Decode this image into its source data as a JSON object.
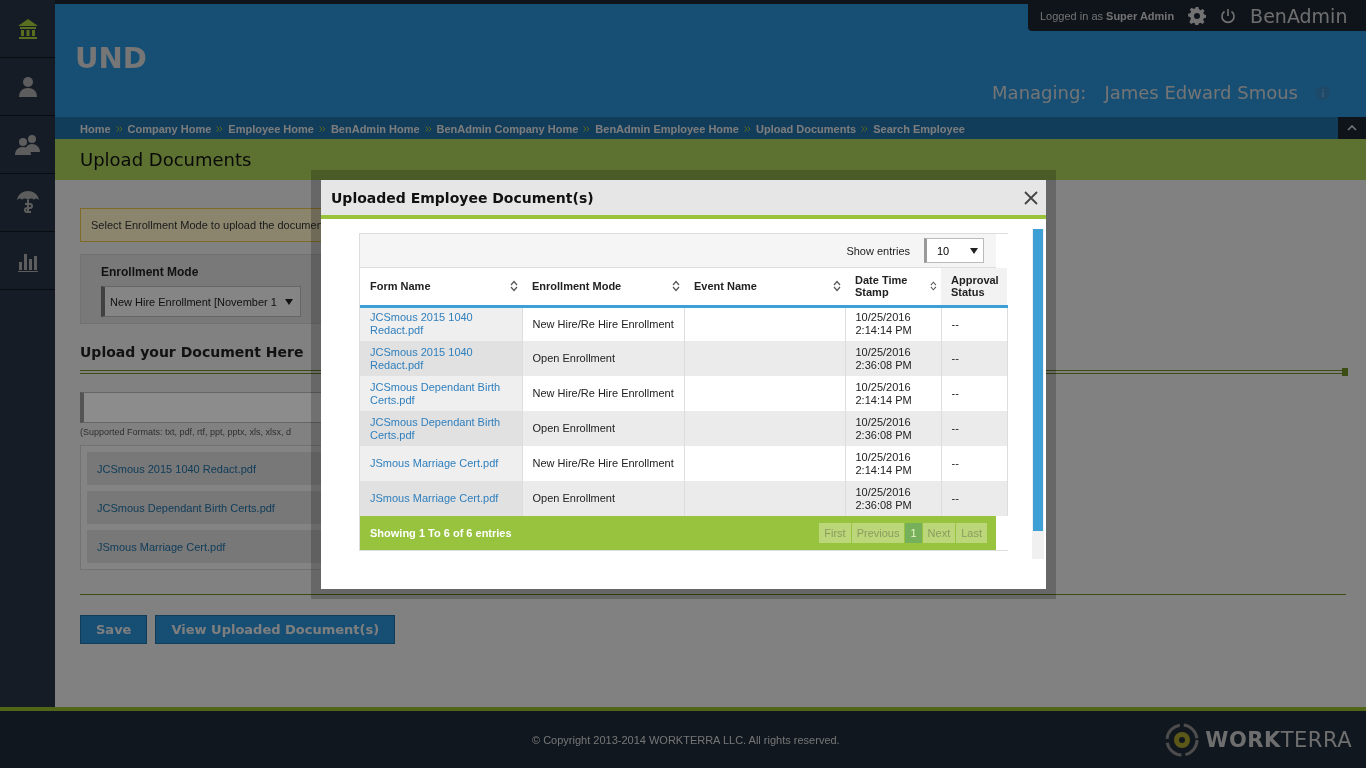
{
  "sidebar": {
    "items": [
      {
        "selected": true
      },
      {
        "selected": false
      },
      {
        "selected": false
      },
      {
        "selected": false
      },
      {
        "selected": false
      }
    ]
  },
  "header": {
    "title": "UND",
    "login_prefix": "Logged in as",
    "login_user": "Super Admin",
    "app_name": "BenAdmin",
    "managing_label": "Managing:",
    "managing_name": "James Edward Smous"
  },
  "breadcrumbs": [
    "Home",
    "Company Home",
    "Employee Home",
    "BenAdmin Home",
    "BenAdmin Company Home",
    "BenAdmin Employee Home",
    "Upload Documents",
    "Search Employee"
  ],
  "page_title": "Upload Documents",
  "notice": "Select Enrollment Mode to upload the documen",
  "enrollment": {
    "label": "Enrollment Mode",
    "value": "New Hire Enrollment [November 1"
  },
  "upload": {
    "heading": "Upload your Document Here",
    "formats": "(Supported Formats: txt, pdf, rtf, ppt, pptx, xls, xlsx, d",
    "files": [
      "JCSmous 2015 1040 Redact.pdf",
      "JCSmous Dependant Birth Certs.pdf",
      "JSmous Marriage Cert.pdf"
    ]
  },
  "buttons": [
    "Save",
    "View Uploaded Document(s)"
  ],
  "footer": {
    "copyright": "© Copyright 2013-2014 WORKTERRA LLC. All rights reserved.",
    "logo": "**WORK**TERRA"
  },
  "modal": {
    "title": "Uploaded Employee Document(s)",
    "show_entries_label": "Show entries",
    "show_entries_value": "10",
    "columns": [
      {
        "label": "Form Name",
        "sortable": true
      },
      {
        "label": "Enrollment Mode",
        "sortable": true
      },
      {
        "label": "Event Name",
        "sortable": true
      },
      {
        "label": "Date Time Stamp",
        "sortable": true
      },
      {
        "label": "Approval Status",
        "sortable": false
      }
    ],
    "rows": [
      {
        "form": "JCSmous 2015 1040 Redact.pdf",
        "mode": "New Hire/Re Hire Enrollment",
        "event": "",
        "date": "10/25/2016",
        "time": "2:14:14 PM",
        "status": "--"
      },
      {
        "form": "JCSmous 2015 1040 Redact.pdf",
        "mode": "Open Enrollment",
        "event": "",
        "date": "10/25/2016",
        "time": "2:36:08 PM",
        "status": "--"
      },
      {
        "form": "JCSmous Dependant Birth Certs.pdf",
        "mode": "New Hire/Re Hire Enrollment",
        "event": "",
        "date": "10/25/2016",
        "time": "2:14:14 PM",
        "status": "--"
      },
      {
        "form": "JCSmous Dependant Birth Certs.pdf",
        "mode": "Open Enrollment",
        "event": "",
        "date": "10/25/2016",
        "time": "2:36:08 PM",
        "status": "--"
      },
      {
        "form": "JSmous Marriage Cert.pdf",
        "mode": "New Hire/Re Hire Enrollment",
        "event": "",
        "date": "10/25/2016",
        "time": "2:14:14 PM",
        "status": "--"
      },
      {
        "form": "JSmous Marriage Cert.pdf",
        "mode": "Open Enrollment",
        "event": "",
        "date": "10/25/2016",
        "time": "2:36:08 PM",
        "status": "--"
      }
    ],
    "info": "Showing 1 To 6 of 6 entries",
    "pagination": [
      {
        "label": "First",
        "selected": false,
        "disabled": true
      },
      {
        "label": "Previous",
        "selected": false,
        "disabled": true
      },
      {
        "label": "1",
        "selected": true,
        "disabled": false
      },
      {
        "label": "Next",
        "selected": false,
        "disabled": true
      },
      {
        "label": "Last",
        "selected": false,
        "disabled": true
      }
    ]
  }
}
